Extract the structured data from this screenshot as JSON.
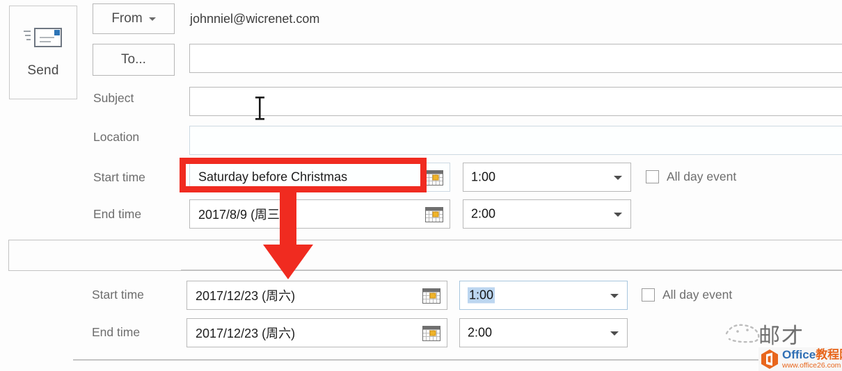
{
  "compose": {
    "send_button": {
      "label": "Send",
      "icon": "send-envelope-icon"
    },
    "from_button": {
      "label": "From",
      "icon": "chevron-down-icon"
    },
    "to_button": {
      "label": "To..."
    },
    "from_address": "johnniel@wicrenet.com",
    "subject": {
      "label": "Subject",
      "value": ""
    },
    "location": {
      "label": "Location",
      "value": ""
    }
  },
  "upper_section": {
    "start_time": {
      "label": "Start time",
      "date_value": "Saturday before Christmas",
      "time_value": "1:00",
      "calendar_icon": "calendar-picker-icon",
      "dropdown_icon": "chevron-down-icon"
    },
    "end_time": {
      "label": "End time",
      "date_value": "2017/8/9 (周三)",
      "time_value": "2:00",
      "calendar_icon": "calendar-picker-icon",
      "dropdown_icon": "chevron-down-icon"
    },
    "all_day_event": {
      "label": "All day event",
      "checked": false
    }
  },
  "lower_section": {
    "start_time": {
      "label": "Start time",
      "date_value": "2017/12/23 (周六)",
      "time_value": "1:00",
      "time_selected": true,
      "calendar_icon": "calendar-picker-icon",
      "dropdown_icon": "chevron-down-icon"
    },
    "end_time": {
      "label": "End time",
      "date_value": "2017/12/23 (周六)",
      "time_value": "2:00",
      "calendar_icon": "calendar-picker-icon",
      "dropdown_icon": "chevron-down-icon"
    },
    "all_day_event": {
      "label": "All day event",
      "checked": false
    }
  },
  "annotation": {
    "highlight_color": "#f02b20",
    "arrow_color": "#f02b20",
    "highlight_target": "upper-start-time-date-field",
    "arrow_target": "lower-start-time-date-field"
  },
  "cursor": {
    "type": "text-ibeam-cursor"
  },
  "watermark": {
    "cn_mark": "邮才",
    "badge_title_blue": "Office",
    "badge_title_orange": "教程网",
    "badge_url": "www.office26.com",
    "badge_icon": "office-hexagon-logo",
    "blue": "#2f6fb5",
    "orange": "#e8661c"
  }
}
